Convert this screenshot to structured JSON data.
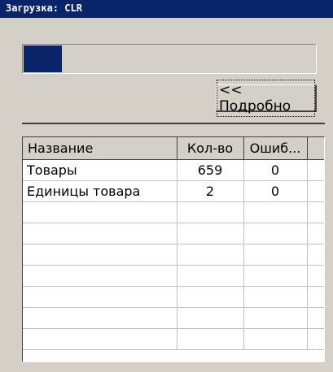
{
  "window": {
    "title": "Загрузка: CLR"
  },
  "progress": {
    "fraction": 0.13
  },
  "details_button": {
    "label": "<< Подробно"
  },
  "table": {
    "columns": [
      "Название",
      "Кол-во",
      "Ошиб...",
      ""
    ],
    "rows": [
      [
        "Товары",
        "659",
        "0"
      ],
      [
        "Единицы товара",
        "2",
        "0"
      ]
    ],
    "empty_rows": 7
  },
  "colors": {
    "titlebar": "#0a246a",
    "window_bg": "#d4d0c8",
    "progress_fill": "#0a246a"
  }
}
